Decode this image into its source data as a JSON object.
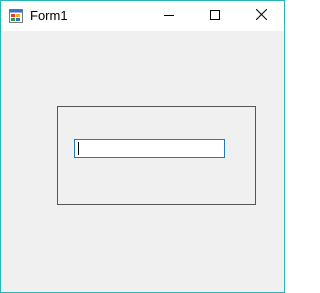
{
  "window": {
    "title": "Form1",
    "border_color": "#2bb4b4",
    "client_background": "#f0f0f0"
  },
  "titlebar": {
    "app_icon": "form-app-icon",
    "minimize_icon": "minimize-icon",
    "maximize_icon": "maximize-icon",
    "close_icon": "close-icon"
  },
  "form": {
    "groupbox": {
      "border_color": "#555555"
    },
    "textbox": {
      "value": "",
      "focused": true,
      "border_color": "#1f7fb4"
    }
  }
}
